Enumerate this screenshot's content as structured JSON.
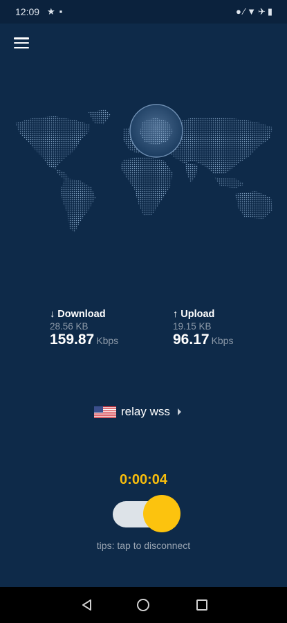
{
  "status_bar": {
    "time": "12:09",
    "left_icons": [
      "star-icon",
      "notification-icon"
    ],
    "right_icons": [
      "vpn-key-icon",
      "data-off-icon",
      "wifi-icon",
      "airplane-icon",
      "battery-icon"
    ]
  },
  "header": {
    "menu_icon": "hamburger-menu-icon"
  },
  "stats": {
    "download": {
      "label": "↓ Download",
      "bytes": "28.56 KB",
      "rate": "159.87",
      "unit": "Kbps"
    },
    "upload": {
      "label": "↑ Upload",
      "bytes": "19.15 KB",
      "rate": "96.17",
      "unit": "Kbps"
    }
  },
  "server": {
    "flag": "us-flag-icon",
    "name": "relay wss"
  },
  "connection": {
    "timer": "0:00:04",
    "toggle_on": true,
    "tip": "tips: tap to disconnect"
  },
  "nav_bar": {
    "icons": [
      "back-icon",
      "home-icon",
      "recents-icon"
    ]
  },
  "colors": {
    "background": "#0e2a49",
    "accent": "#fcc30e",
    "timer": "#f7bd0d",
    "muted_text": "#8c99a8"
  }
}
